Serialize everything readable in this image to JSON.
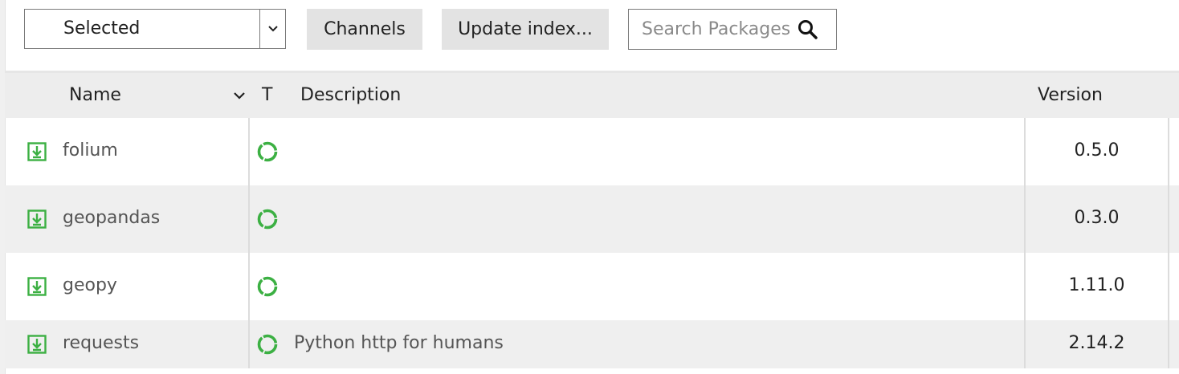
{
  "toolbar": {
    "filter_value": "Selected",
    "channels_label": "Channels",
    "update_label": "Update index...",
    "search_placeholder": "Search Packages"
  },
  "table": {
    "headers": {
      "name": "Name",
      "type": "T",
      "description": "Description",
      "version": "Version"
    },
    "rows": [
      {
        "name": "folium",
        "description": "",
        "version": "0.5.0"
      },
      {
        "name": "geopandas",
        "description": "",
        "version": "0.3.0"
      },
      {
        "name": "geopy",
        "description": "",
        "version": "1.11.0"
      },
      {
        "name": "requests",
        "description": "Python http for humans",
        "version": "2.14.2"
      }
    ]
  },
  "colors": {
    "status_green": "#3cb043",
    "header_bg": "#ededed",
    "alt_row_bg": "#efefef"
  },
  "icons": {
    "row_status": "download-check-icon",
    "row_type": "conda-ring-icon",
    "search": "search-icon",
    "sort": "chevron-down-icon"
  }
}
